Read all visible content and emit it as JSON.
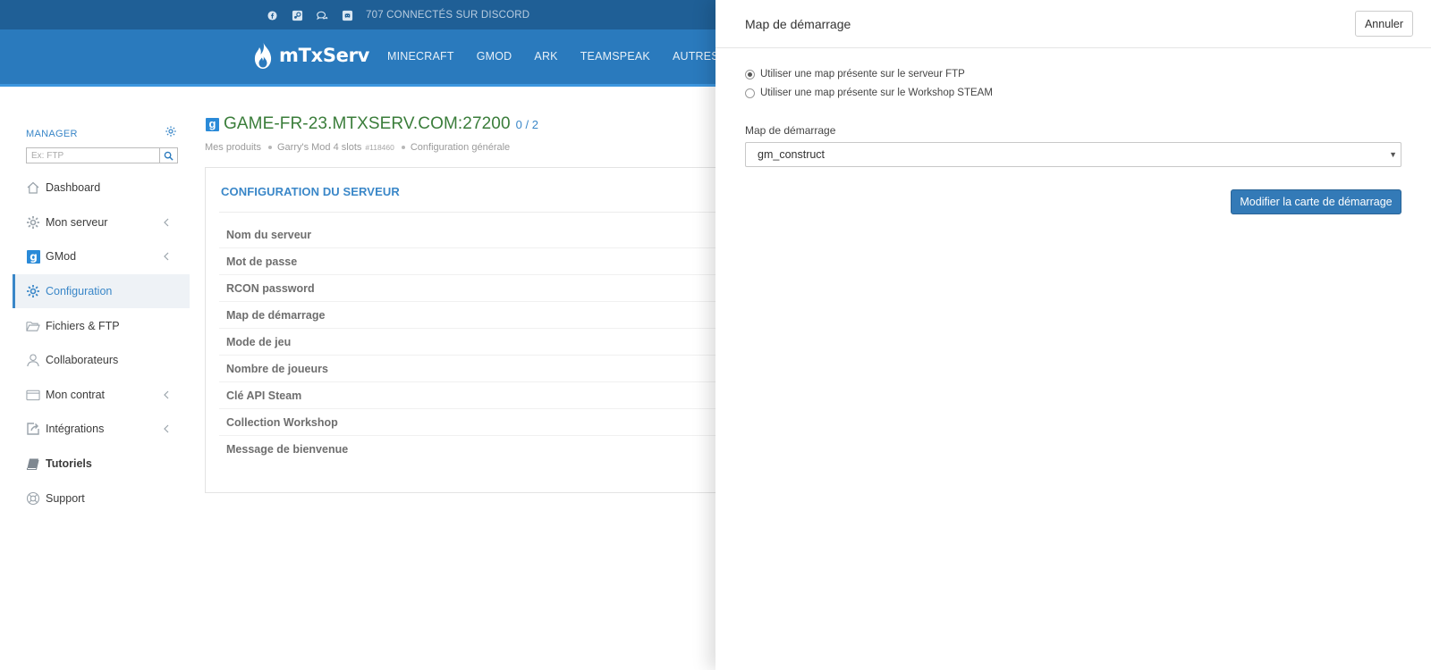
{
  "topbar": {
    "social_icons": [
      "facebook-icon",
      "steam-icon",
      "chat-icon",
      "discord-icon"
    ],
    "discord_text": "707 CONNECTÉS SUR DISCORD"
  },
  "navbar": {
    "brand": "mTxServ",
    "items": [
      "MINECRAFT",
      "GMOD",
      "ARK",
      "TEAMSPEAK",
      "AUTRES JEUX"
    ]
  },
  "sidebar": {
    "manager_label": "MANAGER",
    "search_placeholder": "Ex: FTP",
    "items": [
      {
        "label": "Dashboard",
        "icon": "home-icon"
      },
      {
        "label": "Mon serveur",
        "icon": "gear-icon"
      },
      {
        "label": "GMod",
        "icon": "gmod-icon"
      },
      {
        "label": "Configuration",
        "icon": "gear-icon"
      },
      {
        "label": "Fichiers & FTP",
        "icon": "folder-icon"
      },
      {
        "label": "Collaborateurs",
        "icon": "user-icon"
      },
      {
        "label": "Mon contrat",
        "icon": "card-icon"
      },
      {
        "label": "Intégrations",
        "icon": "share-icon"
      },
      {
        "label": "Tutoriels",
        "icon": "book-icon"
      },
      {
        "label": "Support",
        "icon": "lifebuoy-icon"
      }
    ]
  },
  "main": {
    "game_icon_letter": "g",
    "server_host": "GAME-FR-23.MTXSERV.COM:27200",
    "slots": "0 / 2",
    "breadcrumb": [
      "Mes produits",
      "Garry's Mod 4 slots",
      "Configuration générale"
    ],
    "product_id": "#118460",
    "card_title": "CONFIGURATION DU SERVEUR",
    "rows": [
      "Nom du serveur",
      "Mot de passe",
      "RCON password",
      "Map de démarrage",
      "Mode de jeu",
      "Nombre de joueurs",
      "Clé API Steam",
      "Collection Workshop",
      "Message de bienvenue"
    ]
  },
  "panel": {
    "title": "Map de démarrage",
    "cancel": "Annuler",
    "radio_ftp": "Utiliser une map présente sur le serveur FTP",
    "radio_workshop": "Utiliser une map présente sur le Workshop STEAM",
    "selected_radio": "ftp",
    "map_label": "Map de démarrage",
    "map_value": "gm_construct",
    "submit": "Modifier la carte de démarrage"
  },
  "colors": {
    "topbar": "#1f5f96",
    "navbar": "#2a7abd",
    "accent": "#3a87c8",
    "host_green": "#3a7d3a",
    "primary_button": "#337ab7"
  }
}
